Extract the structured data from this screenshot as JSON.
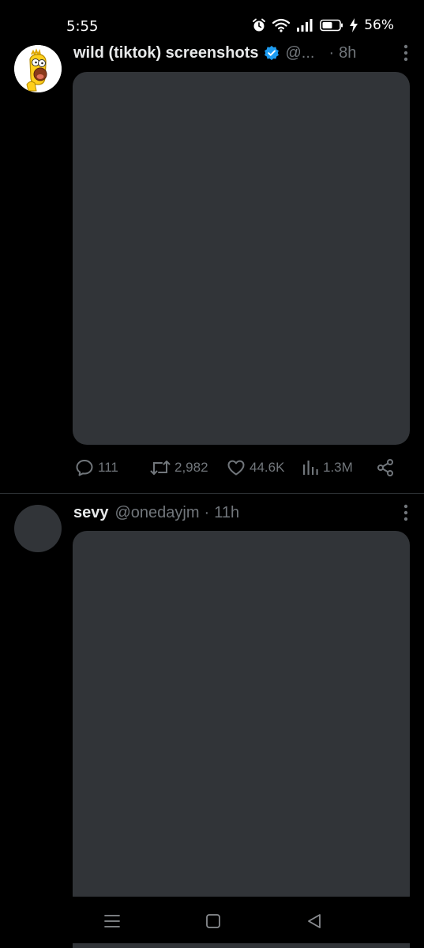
{
  "status_bar": {
    "time": "5:55",
    "battery_percent": "56%",
    "icons": [
      "alarm-icon",
      "wifi-icon",
      "signal-icon",
      "battery-icon",
      "charging-icon"
    ]
  },
  "tweets": [
    {
      "display_name": "wild (tiktok) screenshots",
      "verified": true,
      "handle": "@...",
      "separator": "·",
      "time": "8h",
      "avatar": "cartoon-character",
      "actions": {
        "replies": "111",
        "retweets": "2,982",
        "likes": "44.6K",
        "views": "1.3M"
      }
    },
    {
      "display_name": "sevy",
      "verified": false,
      "handle": "@onedayjm",
      "separator": "·",
      "time": "11h",
      "avatar": "placeholder"
    }
  ],
  "colors": {
    "background": "#000000",
    "media_placeholder": "#313438",
    "verified_blue": "#1d9bf0",
    "secondary_text": "#71767b",
    "primary_text": "#e7e9ea"
  },
  "nav_bar": {
    "icons": [
      "menu-icon",
      "home-square-icon",
      "back-triangle-icon"
    ]
  }
}
